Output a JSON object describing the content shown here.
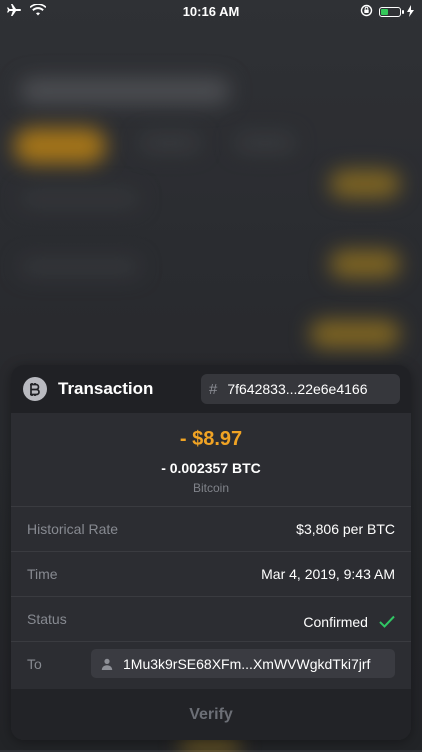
{
  "status_bar": {
    "time": "10:16 AM",
    "icons": [
      "airplane-icon",
      "wifi-icon",
      "orientation-lock-icon",
      "battery-icon",
      "charging-bolt-icon"
    ]
  },
  "colors": {
    "accent": "#f0a324",
    "success": "#30c764",
    "card_bg": "#2c2d32",
    "header_bg": "#202125"
  },
  "transaction": {
    "title": "Transaction",
    "currency_icon": "bitcoin-icon",
    "hash_symbol": "#",
    "hash": "7f642833...22e6e4166",
    "amount_usd": "- $8.97",
    "amount_btc": "- 0.002357 BTC",
    "currency_name": "Bitcoin",
    "details": {
      "historical_rate": {
        "label": "Historical Rate",
        "value": "$3,806 per BTC"
      },
      "time": {
        "label": "Time",
        "value": "Mar 4, 2019, 9:43 AM"
      },
      "status": {
        "label": "Status",
        "value": "Confirmed"
      },
      "to": {
        "label": "To",
        "value": "1Mu3k9rSE68XFm...XmWVWgkdTki7jrf"
      }
    },
    "verify_label": "Verify"
  }
}
